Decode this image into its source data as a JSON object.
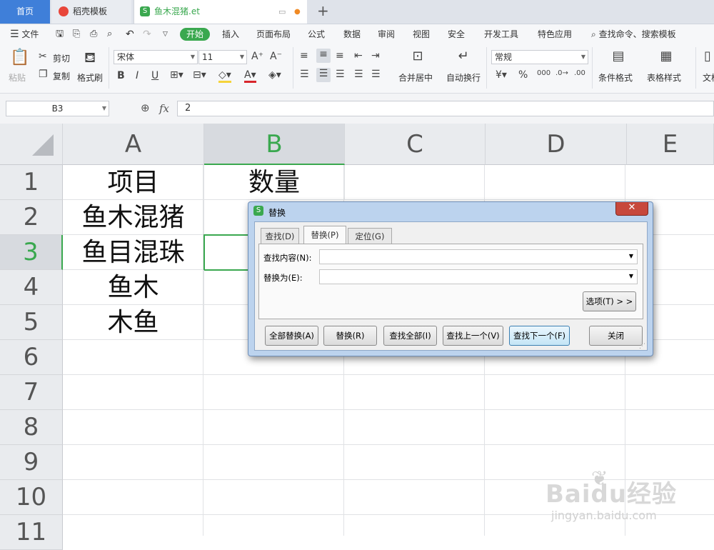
{
  "tabs": {
    "home": "首页",
    "template": "稻壳模板",
    "file": "鱼木混猪.et"
  },
  "menu": {
    "file": "文件",
    "start": "开始",
    "items": [
      "插入",
      "页面布局",
      "公式",
      "数据",
      "审阅",
      "视图",
      "安全",
      "开发工具",
      "特色应用"
    ],
    "search": "查找命令、搜索模板"
  },
  "ribbon": {
    "paste": "粘贴",
    "cut": "剪切",
    "copy": "复制",
    "format_painter": "格式刷",
    "font_name": "宋体",
    "font_size": "11",
    "merge_center": "合并居中",
    "wrap_text": "自动换行",
    "number_format": "常规",
    "conditional_format": "条件格式",
    "table_style": "表格样式",
    "doc_partial": "文档"
  },
  "formula_bar": {
    "name_box": "B3",
    "fx": "fx",
    "value": "2"
  },
  "sheet": {
    "columns": [
      "A",
      "B",
      "C",
      "D",
      "E"
    ],
    "rows": [
      "1",
      "2",
      "3",
      "4",
      "5",
      "6",
      "7",
      "8",
      "9",
      "10",
      "11"
    ],
    "cells": {
      "A1": "项目",
      "B1": "数量",
      "A2": "鱼木混猪",
      "A3": "鱼目混珠",
      "A4": "鱼木",
      "A5": "木鱼"
    }
  },
  "dialog": {
    "title": "替换",
    "close": "✕",
    "tabs": [
      "查找(D)",
      "替换(P)",
      "定位(G)"
    ],
    "find_label": "查找内容(N):",
    "find_value": "",
    "replace_label": "替换为(E):",
    "replace_value": "",
    "options": "选项(T) > >",
    "buttons": {
      "replace_all": "全部替换(A)",
      "replace": "替换(R)",
      "find_all": "查找全部(I)",
      "find_prev": "查找上一个(V)",
      "find_next": "查找下一个(F)",
      "close": "关闭"
    }
  },
  "watermark": {
    "brand": "Baidu经验",
    "url": "jingyan.baidu.com"
  },
  "colors": {
    "accent_green": "#3aa84f",
    "home_tab_blue": "#3f7fd9",
    "dialog_frame": "#bcd3ee"
  }
}
